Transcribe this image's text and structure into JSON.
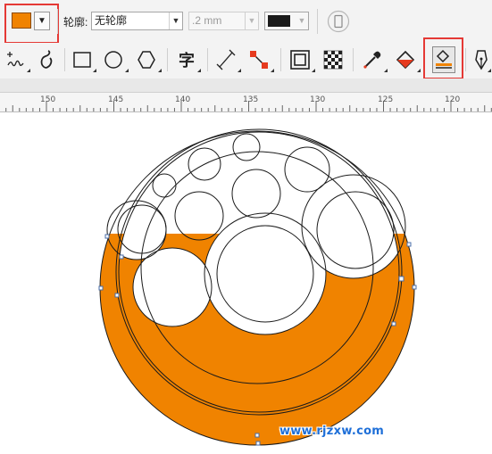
{
  "property_bar": {
    "fill_color": "#f08300",
    "outline_label": "轮廓:",
    "outline_style": "无轮廓",
    "outline_width": ".2 mm",
    "outline_color": "#1a1a1a"
  },
  "toolbox": {
    "text_tool_glyph": "字"
  },
  "ruler": {
    "labels": [
      "150",
      "145",
      "140",
      "135",
      "130",
      "125",
      "120"
    ]
  },
  "canvas": {
    "shape_fill": "#f08300",
    "outline_color": "#1a1a1a"
  },
  "watermark": "www.rjzxw.com"
}
